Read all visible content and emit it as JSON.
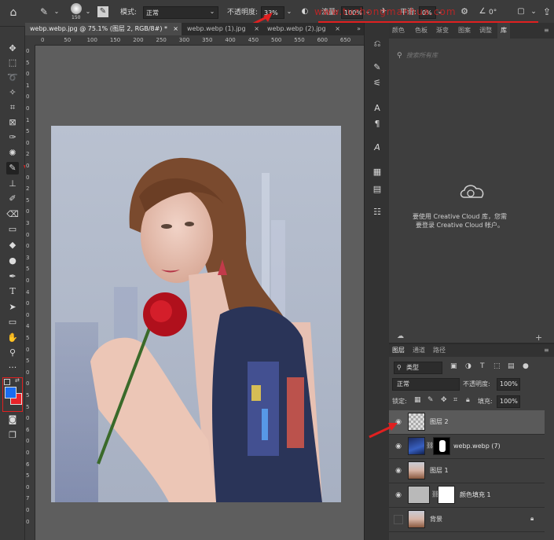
{
  "options_bar": {
    "brush_size": "150",
    "mode_label": "模式:",
    "mode_value": "正常",
    "opacity_label": "不透明度:",
    "opacity_value": "33%",
    "flow_label": "流量:",
    "flow_value": "100%",
    "smoothing_label": "平滑:",
    "smoothing_value": "0%",
    "angle_value": "0°"
  },
  "doc_tabs": [
    {
      "label": "webp.webp.jpg @ 75.1% (图层 2, RGB/8#) *",
      "close": "×"
    },
    {
      "label": "webp.webp (1).jpg",
      "close": "×"
    },
    {
      "label": "webp.webp (2).jpg",
      "close": "×"
    }
  ],
  "ruler_h": [
    "0",
    "50",
    "100",
    "150",
    "200",
    "250",
    "300",
    "350",
    "400",
    "450",
    "500",
    "550",
    "600",
    "650"
  ],
  "ruler_v": [
    "0",
    "5",
    "0",
    "1",
    "0",
    "0",
    "1",
    "5",
    "0",
    "2",
    "0",
    "0",
    "2",
    "5",
    "0",
    "3",
    "0",
    "0",
    "3",
    "5",
    "0",
    "4",
    "0",
    "0",
    "4",
    "5",
    "0",
    "5",
    "0",
    "0",
    "5",
    "5",
    "0",
    "6",
    "0",
    "0",
    "6",
    "5",
    "0",
    "7",
    "0",
    "0"
  ],
  "libraries": {
    "tabs": [
      "颜色",
      "色板",
      "渐变",
      "图案",
      "调整",
      "库"
    ],
    "search_placeholder": "搜索所有库",
    "message": "要使用 Creative Cloud 库，您需要登录 Creative Cloud 帐户。"
  },
  "layers_panel": {
    "tabs": [
      "图层",
      "通道",
      "路径"
    ],
    "filter_kind": "类型",
    "blend_mode": "正常",
    "opacity_label": "不透明度:",
    "opacity_value": "100%",
    "lock_label": "锁定:",
    "fill_label": "填充:",
    "fill_value": "100%",
    "layers": [
      {
        "name": "图层 2",
        "visible": true,
        "selected": true
      },
      {
        "name": "webp.webp (7)",
        "visible": true,
        "selected": false
      },
      {
        "name": "图层 1",
        "visible": true,
        "selected": false
      },
      {
        "name": "颜色填充 1",
        "visible": true,
        "selected": false
      },
      {
        "name": "背景",
        "visible": false,
        "selected": false
      }
    ]
  },
  "colors": {
    "foreground": "#1a6cf0",
    "background": "#e8242a",
    "annotation": "#e02020"
  },
  "watermark": "www.tuzhongmanhua.com"
}
